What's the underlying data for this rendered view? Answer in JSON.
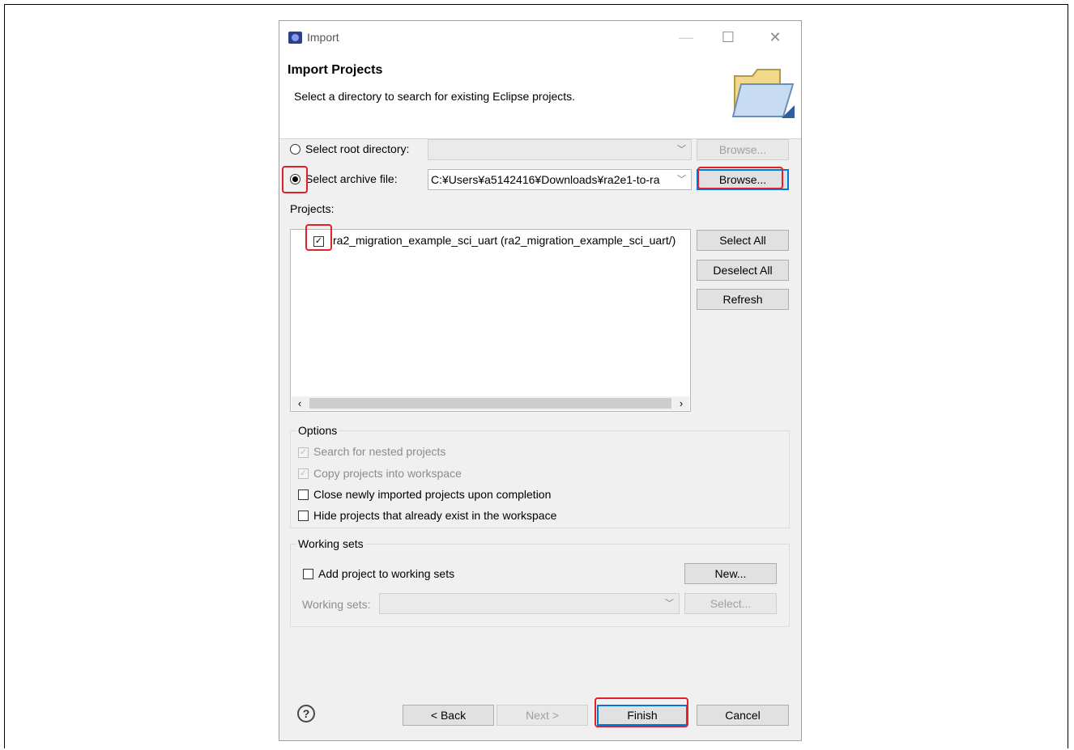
{
  "window": {
    "title": "Import"
  },
  "header": {
    "title": "Import Projects",
    "description": "Select a directory to search for existing Eclipse projects."
  },
  "source": {
    "root_directory_label": "Select root directory:",
    "root_directory_value": "",
    "archive_file_label": "Select archive file:",
    "archive_file_value": "C:¥Users¥a5142416¥Downloads¥ra2e1-to-ra",
    "browse_label": "Browse...",
    "selected": "archive"
  },
  "projects": {
    "label": "Projects:",
    "items": [
      {
        "label": "ra2_migration_example_sci_uart (ra2_migration_example_sci_uart/)",
        "checked": true
      }
    ],
    "select_all": "Select All",
    "deselect_all": "Deselect All",
    "refresh": "Refresh"
  },
  "options": {
    "title": "Options",
    "search_nested": "Search for nested projects",
    "copy_into_workspace": "Copy projects into workspace",
    "close_imported": "Close newly imported projects upon completion",
    "hide_existing": "Hide projects that already exist in the workspace"
  },
  "working_sets": {
    "title": "Working sets",
    "add_label": "Add project to working sets",
    "new_button": "New...",
    "sets_label": "Working sets:",
    "select_button": "Select..."
  },
  "footer": {
    "help": "?",
    "back": "< Back",
    "next": "Next >",
    "finish": "Finish",
    "cancel": "Cancel"
  },
  "colors": {
    "highlight": "#e0202a",
    "accent": "#0078d7"
  }
}
